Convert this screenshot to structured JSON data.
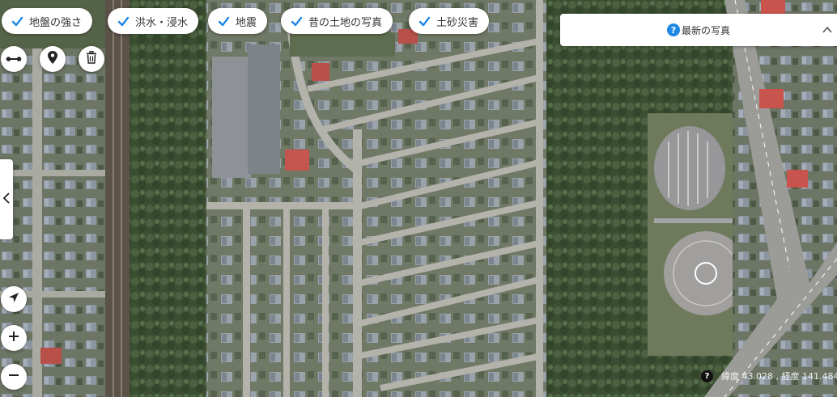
{
  "layer_chips": [
    {
      "label": "地盤の強さ",
      "checked": true
    },
    {
      "label": "洪水・浸水",
      "checked": true
    },
    {
      "label": "地震",
      "checked": true
    },
    {
      "label": "昔の土地の写真",
      "checked": true
    },
    {
      "label": "土砂災害",
      "checked": true
    }
  ],
  "photo_panel": {
    "help_icon": "?",
    "title": "最新の写真"
  },
  "tools": {
    "measure": "distance-measure-icon",
    "pin": "map-pin-icon",
    "delete": "trash-icon"
  },
  "zoom": {
    "locate": "locate-arrow-icon",
    "in": "+",
    "out": "−"
  },
  "coordinates": {
    "help_icon": "?",
    "text": "緯度 43.028 , 経度 141.484"
  },
  "colors": {
    "accent": "#1e88e5",
    "chip_bg": "#ffffff",
    "text": "#333333"
  }
}
